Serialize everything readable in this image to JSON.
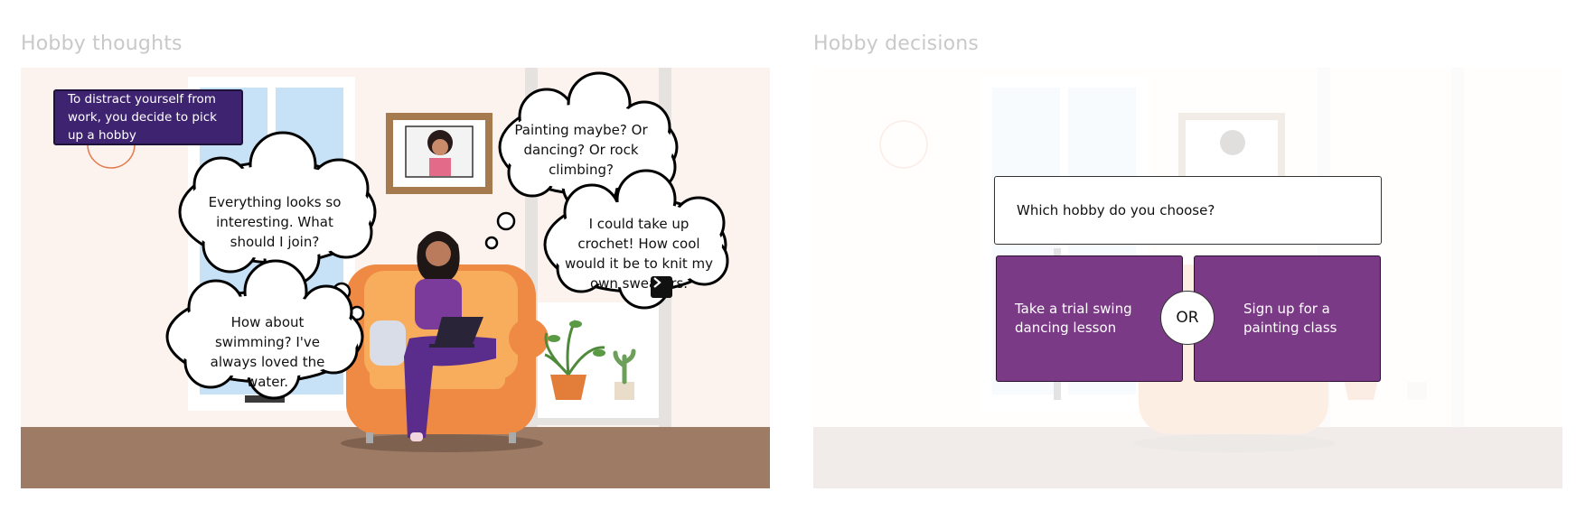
{
  "left_panel": {
    "title": "Hobby thoughts",
    "intro_text": "To distract yourself from work, you decide to pick up a hobby",
    "thoughts": [
      "Everything looks so interesting. What should I join?",
      "How about swimming? I've always loved the water.",
      "Painting maybe? Or dancing? Or rock climbing?",
      "I could take up crochet! How cool would it be to knit my own sweaters."
    ],
    "next_icon": "chevron-right-icon"
  },
  "right_panel": {
    "title": "Hobby decisions",
    "question": "Which hobby do you choose?",
    "choice_a": "Take a trial swing dancing lesson",
    "or_label": "OR",
    "choice_b": "Sign up for a painting class"
  },
  "colors": {
    "intro_bg": "#3e2470",
    "choice_bg": "#7a3a86",
    "floor": "#9e7b65",
    "wall": "#fdf3ee",
    "sofa": "#ef8a44"
  }
}
